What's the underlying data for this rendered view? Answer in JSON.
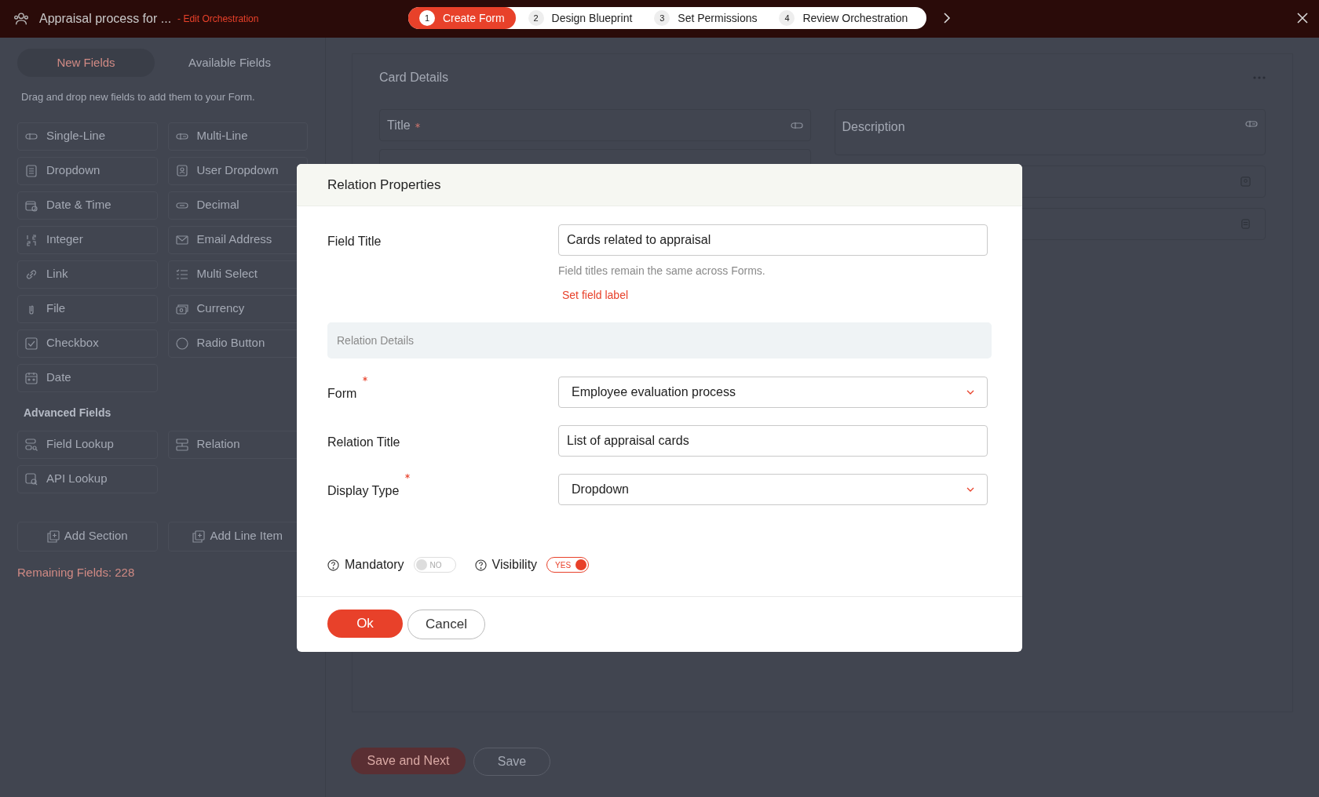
{
  "header": {
    "title": "Appraisal process for ...",
    "subtitle": "- Edit Orchestration"
  },
  "steps": [
    {
      "number": "1",
      "label": "Create Form",
      "selected": true
    },
    {
      "number": "2",
      "label": "Design Blueprint",
      "selected": false
    },
    {
      "number": "3",
      "label": "Set Permissions",
      "selected": false
    },
    {
      "number": "4",
      "label": "Review Orchestration",
      "selected": false
    }
  ],
  "left_panel": {
    "tabs": [
      {
        "label": "New Fields",
        "selected": true
      },
      {
        "label": "Available Fields",
        "selected": false
      }
    ],
    "hint": "Drag and drop new fields to add them to your Form.",
    "fields": [
      "Single-Line",
      "Multi-Line",
      "Dropdown",
      "User Dropdown",
      "Date & Time",
      "Decimal",
      "Integer",
      "Email Address",
      "Link",
      "Multi Select",
      "File",
      "Currency",
      "Checkbox",
      "Radio Button",
      "Date"
    ],
    "advanced_heading": "Advanced Fields",
    "advanced_fields": [
      "Field Lookup",
      "Relation",
      "API Lookup"
    ],
    "actions": [
      "Add Section",
      "Add Line Item"
    ],
    "remaining": "Remaining Fields: 228"
  },
  "card": {
    "title": "Card Details",
    "fields": [
      {
        "label": "Title",
        "required": true
      },
      {
        "label": "Description",
        "required": false
      }
    ]
  },
  "footer_buttons": [
    "Save and Next",
    "Save"
  ],
  "modal": {
    "title": "Relation Properties",
    "field_title": {
      "label": "Field Title",
      "value": "Cards related to appraisal",
      "help": "Field titles remain the same across Forms.",
      "link": "Set field label"
    },
    "section": "Relation Details",
    "rows": [
      {
        "kind": "select",
        "label": "Form",
        "required": true,
        "value": "Employee evaluation process"
      },
      {
        "kind": "input",
        "label": "Relation Title",
        "required": false,
        "value": "List of appraisal cards"
      },
      {
        "kind": "select",
        "label": "Display Type",
        "required": true,
        "value": "Dropdown"
      }
    ],
    "toggles": [
      {
        "label": "Mandatory",
        "on": false,
        "text": "NO"
      },
      {
        "label": "Visibility",
        "on": true,
        "text": "YES"
      }
    ],
    "ok": "Ok",
    "cancel": "Cancel"
  }
}
